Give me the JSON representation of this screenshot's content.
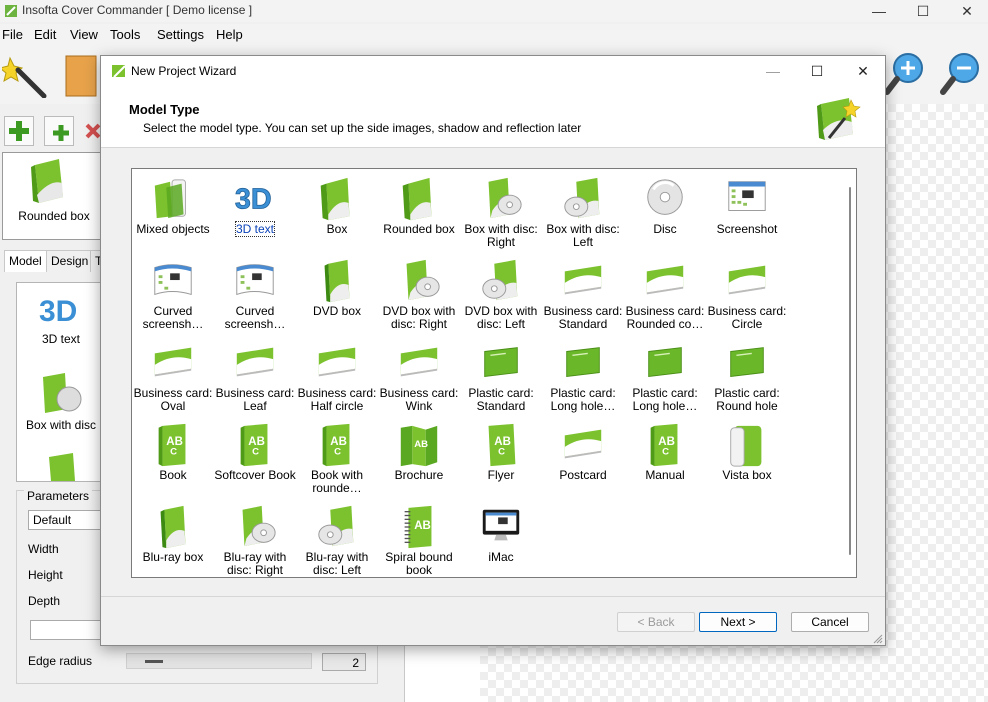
{
  "app": {
    "title": "Insofta Cover Commander [ Demo license ]",
    "window_controls": [
      "—",
      "☐",
      "✕"
    ]
  },
  "menu": [
    "File",
    "Edit",
    "View",
    "Tools",
    "Settings",
    "Help"
  ],
  "left_panel": {
    "thumbnail_label": "Rounded box",
    "tabs": [
      "Model",
      "Design",
      "T"
    ],
    "model_list": [
      "3D text",
      "Box with disc"
    ],
    "params_title": "Parameters",
    "preset_value": "Default",
    "labels": {
      "width": "Width",
      "height": "Height",
      "depth": "Depth",
      "edge_radius": "Edge radius"
    },
    "edge_radius_value": "2"
  },
  "dialog": {
    "title": "New Project Wizard",
    "header_title": "Model Type",
    "header_subtitle": "Select the model type. You can set up the side images, shadow and reflection later",
    "selected": "3D text",
    "items": [
      {
        "label": "Mixed objects",
        "icon": "mixed"
      },
      {
        "label": "3D text",
        "icon": "text3d"
      },
      {
        "label": "Box",
        "icon": "box"
      },
      {
        "label": "Rounded box",
        "icon": "box"
      },
      {
        "label": "Box with disc: Right",
        "icon": "boxdiscR"
      },
      {
        "label": "Box with disc: Left",
        "icon": "boxdiscL"
      },
      {
        "label": "Disc",
        "icon": "disc"
      },
      {
        "label": "Screenshot",
        "icon": "screenshot"
      },
      {
        "label": "Curved screensh…",
        "icon": "curvedshot"
      },
      {
        "label": "Curved screensh…",
        "icon": "curvedshot"
      },
      {
        "label": "DVD box",
        "icon": "dvd"
      },
      {
        "label": "DVD box with disc: Right",
        "icon": "boxdiscR"
      },
      {
        "label": "DVD box with disc: Left",
        "icon": "boxdiscL"
      },
      {
        "label": "Business card: Standard",
        "icon": "card"
      },
      {
        "label": "Business card: Rounded co…",
        "icon": "card"
      },
      {
        "label": "Business card: Circle",
        "icon": "card"
      },
      {
        "label": "Business card: Oval",
        "icon": "card"
      },
      {
        "label": "Business card: Leaf",
        "icon": "card"
      },
      {
        "label": "Business card: Half circle",
        "icon": "card"
      },
      {
        "label": "Business card: Wink",
        "icon": "card"
      },
      {
        "label": "Plastic card: Standard",
        "icon": "plastic"
      },
      {
        "label": "Plastic card: Long hole…",
        "icon": "plastic"
      },
      {
        "label": "Plastic card: Long hole…",
        "icon": "plastic"
      },
      {
        "label": "Plastic card: Round hole",
        "icon": "plastic"
      },
      {
        "label": "Book",
        "icon": "book"
      },
      {
        "label": "Softcover Book",
        "icon": "book"
      },
      {
        "label": "Book with rounde…",
        "icon": "book"
      },
      {
        "label": "Brochure",
        "icon": "brochure"
      },
      {
        "label": "Flyer",
        "icon": "flyer"
      },
      {
        "label": "Postcard",
        "icon": "card"
      },
      {
        "label": "Manual",
        "icon": "book"
      },
      {
        "label": "Vista box",
        "icon": "vista"
      },
      {
        "label": "Blu-ray box",
        "icon": "dvd"
      },
      {
        "label": "Blu-ray with disc: Right",
        "icon": "boxdiscR"
      },
      {
        "label": "Blu-ray with disc: Left",
        "icon": "boxdiscL"
      },
      {
        "label": "Spiral bound book",
        "icon": "spiral"
      },
      {
        "label": "iMac",
        "icon": "imac"
      }
    ],
    "buttons": {
      "back": "< Back",
      "next": "Next >",
      "cancel": "Cancel"
    }
  },
  "colors": {
    "green": "#7cc22e",
    "green_dark": "#4f9a16",
    "accent_blue": "#0067c0"
  }
}
